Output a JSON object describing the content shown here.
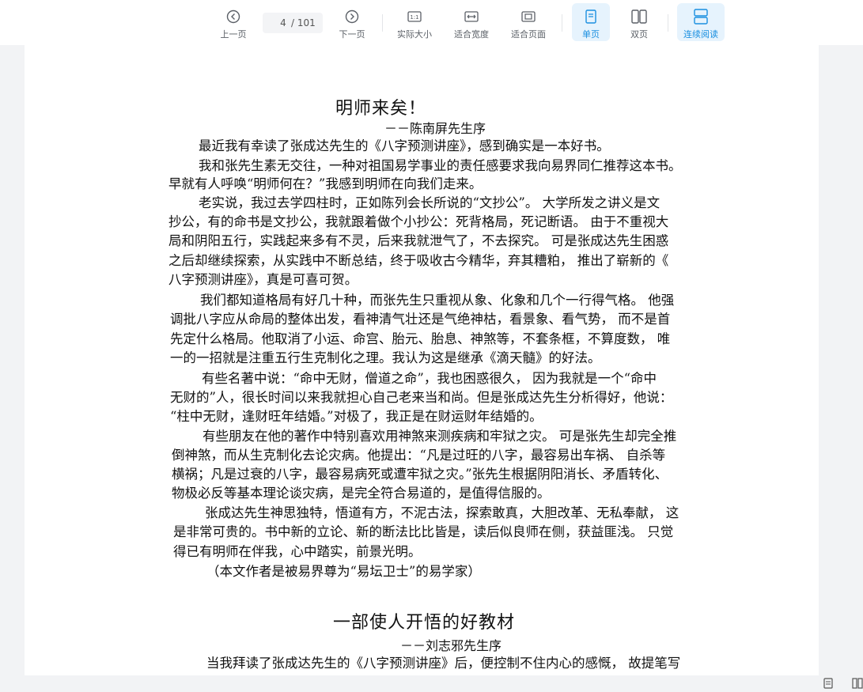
{
  "toolbar": {
    "prev": {
      "label": "上一页",
      "icon": "chevron-left-circle-icon"
    },
    "page_current": "4",
    "page_total": "/ 101",
    "next": {
      "label": "下一页",
      "icon": "chevron-right-circle-icon"
    },
    "actual_size": {
      "label": "实际大小",
      "icon": "one-to-one-icon"
    },
    "fit_width": {
      "label": "适合宽度",
      "icon": "fit-width-icon"
    },
    "fit_page": {
      "label": "适合页面",
      "icon": "fit-page-icon"
    },
    "single": {
      "label": "单页",
      "icon": "single-page-icon",
      "active": true
    },
    "double": {
      "label": "双页",
      "icon": "double-page-icon"
    },
    "continuous": {
      "label": "连续阅读",
      "icon": "continuous-read-icon",
      "active": true
    },
    "accent_color": "#1a8fe0"
  },
  "document": {
    "title1": "明师来矣！",
    "title1_sub": "－－陈南屏先生序",
    "lines1": [
      "最近我有幸读了张成达先生的《八字预测讲座》，感到确实是一本好书。",
      "我和张先生素无交往，一种对祖国易学事业的责任感要求我向易界同仁推荐这本书。",
      "早就有人呼唤“明师何在？”我感到明师在向我们走来。",
      "老实说，我过去学四柱时，正如陈列会长所说的“文抄公”。 大学所发之讲义是文",
      "抄公，有的命书是文抄公，我就跟着做个小抄公：死背格局，死记断语。 由于不重视大",
      "局和阴阳五行，实践起来多有不灵，后来我就泄气了，不去探究。 可是张成达先生困惑",
      "之后却继续探索，从实践中不断总结，终于吸收古今精华，弃其糟粕， 推出了崭新的《",
      "八字预测讲座》，真是可喜可贺。",
      "我们都知道格局有好几十种，而张先生只重视从象、化象和几个一行得气格。 他强",
      "调批八字应从命局的整体出发，看神清气壮还是气绝神枯，看景象、看气势， 而不是首",
      "先定什么格局。他取消了小运、命宫、胎元、胎息、神煞等，不套条框，不算度数， 唯",
      "一的一招就是注重五行生克制化之理。我认为这是继承《滴天髓》的好法。",
      "有些名著中说：“命中无财，僧道之命”，我也困惑很久， 因为我就是一个“命中",
      "无财的”人，很长时间以来我就担心自己老来当和尚。但是张成达先生分析得好，他说：",
      "“柱中无财，逢财旺年结婚。”对极了，我正是在财运财年结婚的。",
      "有些朋友在他的著作中特别喜欢用神煞来测疾病和牢狱之灾。 可是张先生却完全推",
      "倒神煞，而从生克制化去论灾病。他提出：“凡是过旺的八字，最容易出车祸、 自杀等",
      "横祸；凡是过衰的八字，最容易病死或遭牢狱之灾。”张先生根据阴阳消长、矛盾转化、",
      "物极必反等基本理论谈灾病，是完全符合易道的，是值得信服的。",
      "张成达先生神思独特，悟道有方，不泥古法，探索敢真，大胆改革、无私奉献， 这",
      "是非常可贵的。书中新的立论、新的断法比比皆是，读后似良师在侧，获益匪浅。 只觉",
      "得已有明师在伴我，心中踏实，前景光明。",
      "（本文作者是被易界尊为“易坛卫士”的易学家）"
    ],
    "title2": "一部使人开悟的好教材",
    "title2_sub": "－－刘志邪先生序",
    "lines2": [
      "当我拜读了张成达先生的《八字预测讲座》后，便控制不住内心的感慨， 故提笔写"
    ]
  },
  "statusbar": {
    "icon1": "page-view-icon",
    "icon2": "columns-icon"
  }
}
